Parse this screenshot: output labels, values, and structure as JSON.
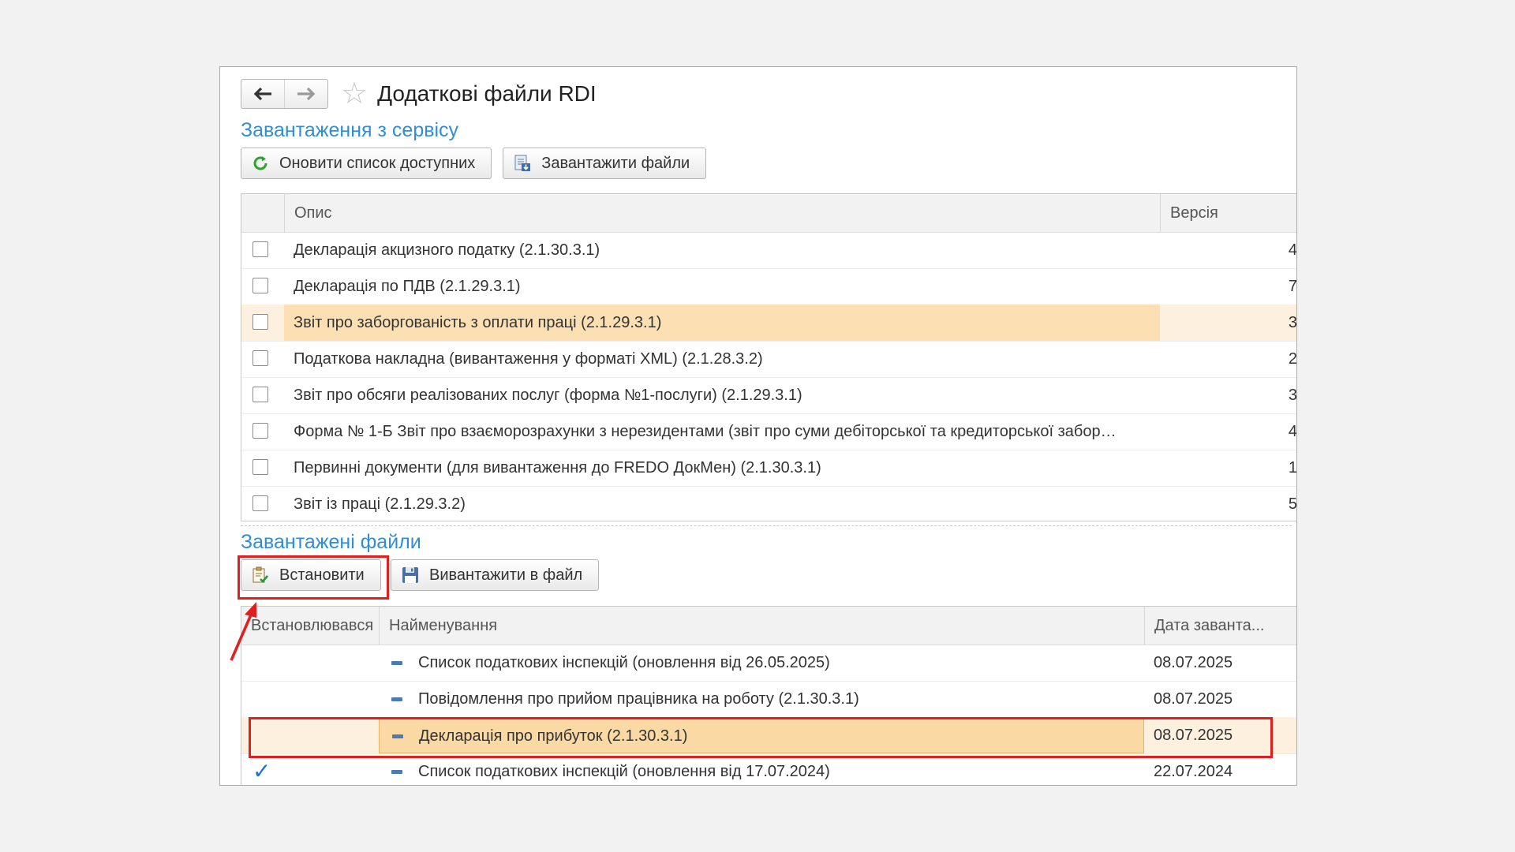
{
  "window": {
    "title": "Додаткові файли RDI",
    "nav": {
      "back_icon": "arrow-left-icon",
      "forward_icon": "arrow-right-icon",
      "favorite_icon": "star-icon"
    }
  },
  "service_section": {
    "title": "Завантаження з сервісу",
    "buttons": {
      "refresh_label": "Оновити список доступних",
      "download_label": "Завантажити файли"
    },
    "columns": {
      "description": "Опис",
      "version": "Версія"
    },
    "rows": [
      {
        "description": "Декларація акцизного податку (2.1.30.3.1)",
        "version": "4"
      },
      {
        "description": "Декларація по ПДВ (2.1.29.3.1)",
        "version": "7"
      },
      {
        "description": "Звіт про заборгованість з оплати праці (2.1.29.3.1)",
        "version": "3"
      },
      {
        "description": "Податкова накладна (вивантаження у форматі XML) (2.1.28.3.2)",
        "version": "2"
      },
      {
        "description": "Звіт про обсяги реалізованих послуг (форма №1-послуги) (2.1.29.3.1)",
        "version": "3"
      },
      {
        "description": "Форма № 1-Б Звіт про взаєморозрахунки з нерезидентами (звіт про суми дебіторської та кредиторської забор…",
        "version": "4"
      },
      {
        "description": "Первинні документи (для вивантаження до FREDO ДокМен) (2.1.30.3.1)",
        "version": "1"
      },
      {
        "description": "Звіт із праці (2.1.29.3.2)",
        "version": "5"
      }
    ]
  },
  "downloaded_section": {
    "title": "Завантажені файли",
    "buttons": {
      "install_label": "Встановити",
      "export_label": "Вивантажити в файл"
    },
    "columns": {
      "installed": "Встановлювався",
      "name": "Найменування",
      "date": "Дата заванта..."
    },
    "rows": [
      {
        "name": "Список податкових інспекцій (оновлення від 26.05.2025)",
        "date": "08.07.2025",
        "installed": ""
      },
      {
        "name": "Повідомлення про прийом працівника на роботу (2.1.30.3.1)",
        "date": "08.07.2025",
        "installed": ""
      },
      {
        "name": "Декларація про прибуток (2.1.30.3.1)",
        "date": "08.07.2025",
        "installed": ""
      },
      {
        "name": "Список податкових інспекцій (оновлення від 17.07.2024)",
        "date": "22.07.2024",
        "installed": "✓"
      }
    ]
  },
  "colors": {
    "accent": "#2f8ed6",
    "highlight": "#fce0b3",
    "annotation": "#e31e1e",
    "check": "#1a73d9"
  }
}
